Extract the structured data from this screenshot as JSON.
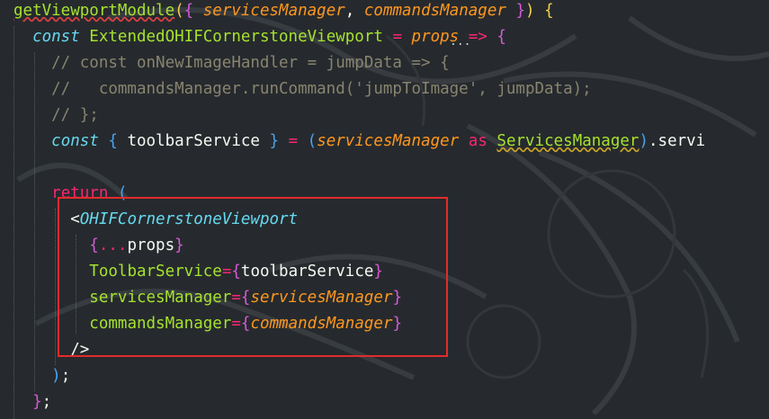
{
  "editor": {
    "lines": [
      {
        "tokens": [
          {
            "t": "getViewportModule",
            "c": "tok-fn squiggle-red"
          },
          {
            "t": "(",
            "c": "tok-brace-y"
          },
          {
            "t": "{ ",
            "c": "tok-brace-p"
          },
          {
            "t": "servicesManager",
            "c": "tok-param"
          },
          {
            "t": ", ",
            "c": "tok-plain"
          },
          {
            "t": "commandsManager",
            "c": "tok-param"
          },
          {
            "t": " }",
            "c": "tok-brace-p"
          },
          {
            "t": ") ",
            "c": "tok-brace-y"
          },
          {
            "t": "{",
            "c": "tok-brace-y"
          }
        ]
      },
      {
        "tokens": [
          {
            "t": "  ",
            "c": "tok-plain"
          },
          {
            "t": "const ",
            "c": "tok-kw"
          },
          {
            "t": "ExtendedOHIFCornerstoneViewport",
            "c": "tok-var"
          },
          {
            "t": " = ",
            "c": "tok-op"
          },
          {
            "t": "props",
            "c": "tok-param"
          },
          {
            "t": " => ",
            "c": "tok-op"
          },
          {
            "t": "{",
            "c": "tok-brace-p"
          }
        ]
      },
      {
        "tokens": [
          {
            "t": "    // const onNewImageHandler = jumpData => {",
            "c": "tok-cmt"
          }
        ]
      },
      {
        "tokens": [
          {
            "t": "    //   commandsManager.runCommand('jumpToImage', jumpData);",
            "c": "tok-cmt"
          }
        ]
      },
      {
        "tokens": [
          {
            "t": "    // };",
            "c": "tok-cmt"
          }
        ]
      },
      {
        "tokens": [
          {
            "t": "    ",
            "c": "tok-plain"
          },
          {
            "t": "const ",
            "c": "tok-kw"
          },
          {
            "t": "{ ",
            "c": "tok-brace-b"
          },
          {
            "t": "toolbarService",
            "c": "tok-plain"
          },
          {
            "t": " } ",
            "c": "tok-brace-b"
          },
          {
            "t": "= ",
            "c": "tok-op"
          },
          {
            "t": "(",
            "c": "tok-brace-b"
          },
          {
            "t": "servicesManager",
            "c": "tok-param"
          },
          {
            "t": " as ",
            "c": "tok-op"
          },
          {
            "t": "ServicesManager",
            "c": "tok-type"
          },
          {
            "t": ")",
            "c": "tok-brace-b"
          },
          {
            "t": ".servi",
            "c": "tok-plain"
          }
        ]
      },
      {
        "tokens": [
          {
            "t": "",
            "c": "tok-plain"
          }
        ]
      },
      {
        "tokens": [
          {
            "t": "    ",
            "c": "tok-plain"
          },
          {
            "t": "return ",
            "c": "tok-ret"
          },
          {
            "t": "(",
            "c": "tok-brace-b"
          }
        ]
      },
      {
        "tokens": [
          {
            "t": "      ",
            "c": "tok-plain"
          },
          {
            "t": "<",
            "c": "tok-plain"
          },
          {
            "t": "OHIFCornerstoneViewport",
            "c": "tok-tag"
          }
        ]
      },
      {
        "tokens": [
          {
            "t": "        ",
            "c": "tok-plain"
          },
          {
            "t": "{",
            "c": "tok-brace-p"
          },
          {
            "t": "...",
            "c": "tok-op"
          },
          {
            "t": "props",
            "c": "tok-plain"
          },
          {
            "t": "}",
            "c": "tok-brace-p"
          }
        ]
      },
      {
        "tokens": [
          {
            "t": "        ",
            "c": "tok-plain"
          },
          {
            "t": "ToolbarService",
            "c": "tok-attr"
          },
          {
            "t": "=",
            "c": "tok-op"
          },
          {
            "t": "{",
            "c": "tok-brace-p"
          },
          {
            "t": "toolbarService",
            "c": "tok-plain"
          },
          {
            "t": "}",
            "c": "tok-brace-p"
          }
        ]
      },
      {
        "tokens": [
          {
            "t": "        ",
            "c": "tok-plain"
          },
          {
            "t": "servicesManager",
            "c": "tok-attr"
          },
          {
            "t": "=",
            "c": "tok-op"
          },
          {
            "t": "{",
            "c": "tok-brace-p"
          },
          {
            "t": "servicesManager",
            "c": "tok-param"
          },
          {
            "t": "}",
            "c": "tok-brace-p"
          }
        ]
      },
      {
        "tokens": [
          {
            "t": "        ",
            "c": "tok-plain"
          },
          {
            "t": "commandsManager",
            "c": "tok-attr"
          },
          {
            "t": "=",
            "c": "tok-op"
          },
          {
            "t": "{",
            "c": "tok-brace-p"
          },
          {
            "t": "commandsManager",
            "c": "tok-param"
          },
          {
            "t": "}",
            "c": "tok-brace-p"
          }
        ]
      },
      {
        "tokens": [
          {
            "t": "      ",
            "c": "tok-plain"
          },
          {
            "t": "/>",
            "c": "tok-plain"
          }
        ]
      },
      {
        "tokens": [
          {
            "t": "    ",
            "c": "tok-plain"
          },
          {
            "t": ")",
            "c": "tok-brace-b"
          },
          {
            "t": ";",
            "c": "tok-plain"
          }
        ]
      },
      {
        "tokens": [
          {
            "t": "  ",
            "c": "tok-plain"
          },
          {
            "t": "}",
            "c": "tok-brace-p"
          },
          {
            "t": ";",
            "c": "tok-plain"
          }
        ]
      }
    ],
    "hover_hint": "..."
  },
  "colors": {
    "background": "#262a2e",
    "highlight_box": "#e32b2b"
  }
}
